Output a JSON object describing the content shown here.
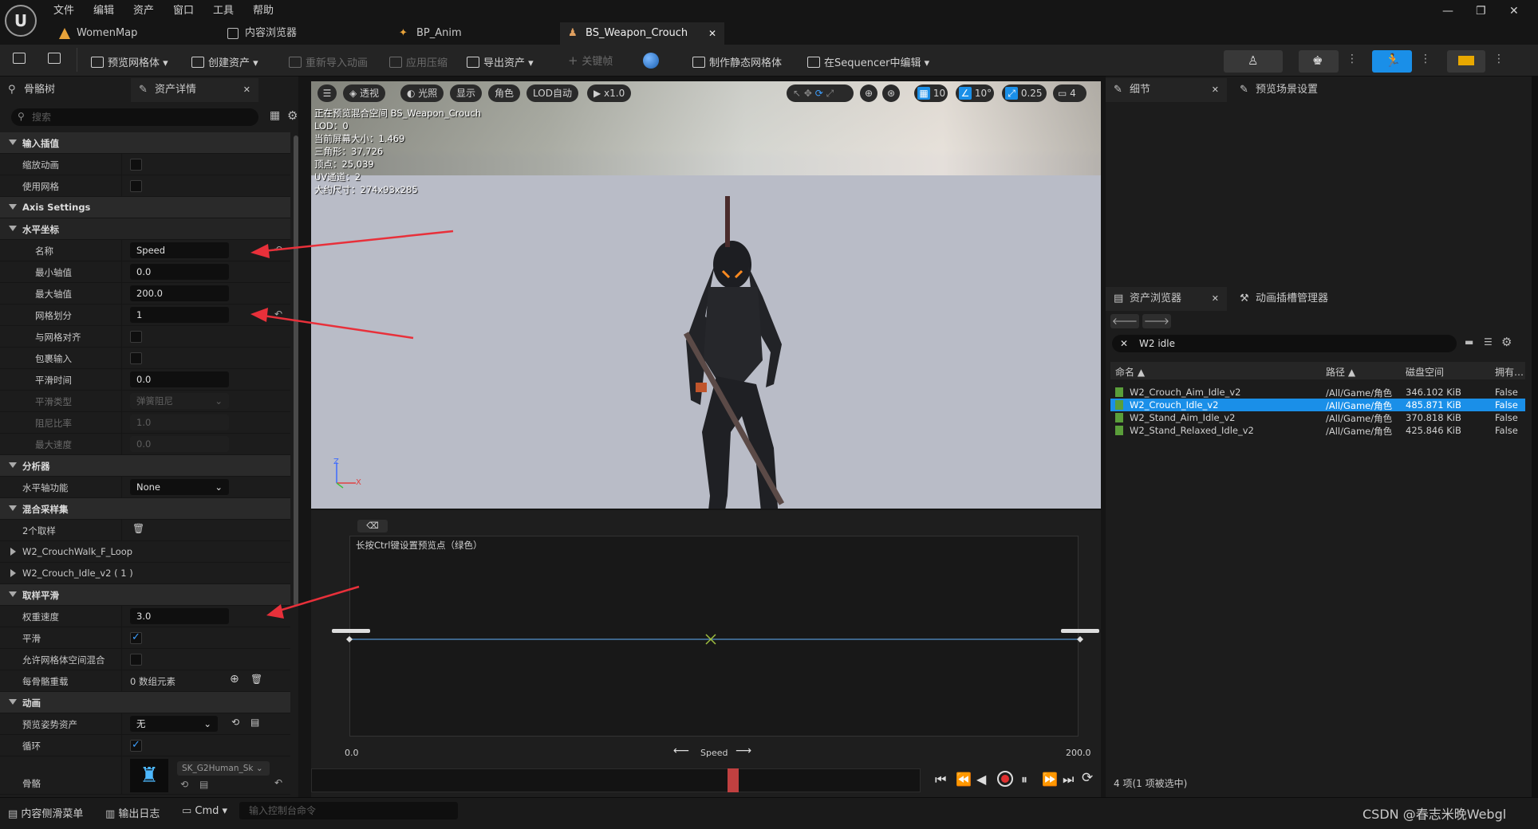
{
  "menu": [
    "文件",
    "编辑",
    "资产",
    "窗口",
    "工具",
    "帮助"
  ],
  "tabs": [
    {
      "label": "WomenMap"
    },
    {
      "label": "内容浏览器"
    },
    {
      "label": "BP_Anim"
    },
    {
      "label": "BS_Weapon_Crouch"
    }
  ],
  "toolbar": {
    "preview_mesh": "预览网格体",
    "create_asset": "创建资产",
    "reimport": "重新导入动画",
    "apply_compress": "应用压缩",
    "export_asset": "导出资产",
    "keyframe": "关键帧",
    "make_static": "制作静态网格体",
    "sequencer": "在Sequencer中编辑"
  },
  "left": {
    "tab_skeleton": "骨骼树",
    "tab_asset_details": "资产详情",
    "search_placeholder": "搜索",
    "rows": {
      "input_interp": "输入插值",
      "scale_anim": "缩放动画",
      "use_mesh": "使用网格",
      "axis_settings": "Axis Settings",
      "horizontal": "水平坐标",
      "name": "名称",
      "name_val": "Speed",
      "min": "最小轴值",
      "min_val": "0.0",
      "max": "最大轴值",
      "max_val": "200.0",
      "grid_div": "网格划分",
      "grid_div_val": "1",
      "snap": "与网格对齐",
      "wrap": "包裹输入",
      "smooth_time": "平滑时间",
      "smooth_time_val": "0.0",
      "smooth_type": "平滑类型",
      "smooth_type_val": "弹簧阻尼",
      "damping": "阻尼比率",
      "damping_val": "1.0",
      "max_speed": "最大速度",
      "max_speed_val": "0.0",
      "analysis": "分析器",
      "h_axis_func": "水平轴功能",
      "h_axis_func_val": "None",
      "blend_samples": "混合采样集",
      "samples_count": "2个取样",
      "sample1": "W2_CrouchWalk_F_Loop",
      "sample2": "W2_Crouch_Idle_v2 ( 1 )",
      "sample_smooth": "取样平滑",
      "weight_speed": "权重速度",
      "weight_speed_val": "3.0",
      "smooth": "平滑",
      "allow_mesh_space": "允许网格体空间混合",
      "per_bone": "每骨骼重载",
      "per_bone_val": "0 数组元素",
      "animation": "动画",
      "preview_pose": "预览姿势资产",
      "preview_pose_val": "无",
      "loop": "循环",
      "skeleton": "骨骼",
      "skeleton_val": "SK_G2Human_Sk"
    }
  },
  "viewport": {
    "buttons": [
      "透视",
      "光照",
      "显示",
      "角色",
      "LOD自动",
      "x1.0"
    ],
    "right_values": [
      "10",
      "10°",
      "0.25",
      "4"
    ],
    "info": [
      "正在预览混合空间 BS_Weapon_Crouch",
      "LOD：0",
      "当前屏幕大小：1.469",
      "三角形：37,726",
      "顶点：25,039",
      "UV通道：2",
      "大约尺寸：274x93x285"
    ],
    "axis_z": "Z",
    "axis_x": "X"
  },
  "blend": {
    "hint": "长按Ctrl键设置预览点（绿色）",
    "axis_name": "Speed",
    "min_label": "0.0",
    "max_label": "200.0"
  },
  "right": {
    "details_tab": "细节",
    "preview_scene_tab": "预览场景设置",
    "asset_browser_tab": "资产浏览器",
    "anim_slot_tab": "动画插槽管理器",
    "search_value": "W2 idle",
    "columns": [
      "命名",
      "路径",
      "磁盘空间",
      "拥有…"
    ],
    "rows": [
      {
        "name": "W2_Crouch_Aim_Idle_v2",
        "path": "/All/Game/角色",
        "size": "346.102 KiB",
        "owner": "False"
      },
      {
        "name": "W2_Crouch_Idle_v2",
        "path": "/All/Game/角色",
        "size": "485.871 KiB",
        "owner": "False"
      },
      {
        "name": "W2_Stand_Aim_Idle_v2",
        "path": "/All/Game/角色",
        "size": "370.818 KiB",
        "owner": "False"
      },
      {
        "name": "W2_Stand_Relaxed_Idle_v2",
        "path": "/All/Game/角色",
        "size": "425.846 KiB",
        "owner": "False"
      }
    ],
    "status": "4 项(1 项被选中)"
  },
  "bottom": {
    "content_drawer": "内容侧滑菜单",
    "output_log": "输出日志",
    "cmd": "Cmd",
    "console_placeholder": "输入控制台命令",
    "watermark": "CSDN @春志米晚Webgl"
  },
  "colors": {
    "accent": "#1a8fe8",
    "arrow": "#e8303a"
  }
}
